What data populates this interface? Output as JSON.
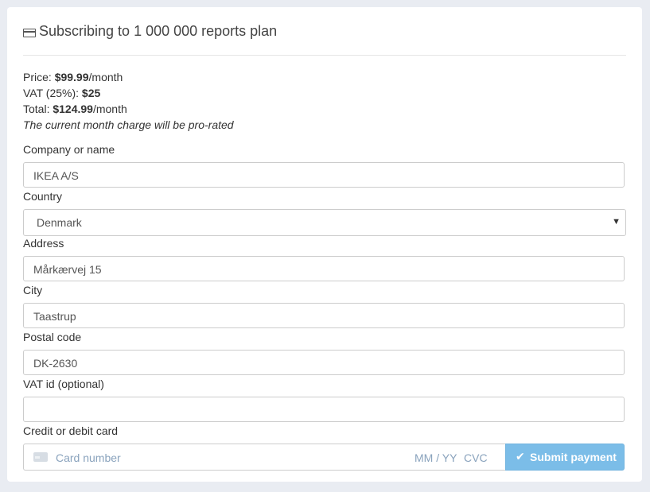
{
  "header": {
    "title": "Subscribing to 1 000 000 reports plan",
    "icon": "credit-card-icon"
  },
  "pricing": {
    "price_label": "Price: ",
    "price_value": "$99.99",
    "price_suffix": "/month",
    "vat_label": "VAT (25%): ",
    "vat_value": "$25",
    "total_label": "Total: ",
    "total_value": "$124.99",
    "total_suffix": "/month",
    "note": "The current month charge will be pro-rated"
  },
  "form": {
    "company": {
      "label": "Company or name",
      "value": "IKEA A/S"
    },
    "country": {
      "label": "Country",
      "value": "Denmark"
    },
    "address": {
      "label": "Address",
      "value": "Mårkærvej 15"
    },
    "city": {
      "label": "City",
      "value": "Taastrup"
    },
    "postal": {
      "label": "Postal code",
      "value": "DK-2630"
    },
    "vat_id": {
      "label": "VAT id (optional)",
      "value": ""
    },
    "card": {
      "label": "Credit or debit card",
      "number_placeholder": "Card number",
      "expiry_placeholder": "MM / YY",
      "cvc_placeholder": "CVC"
    },
    "submit_label": "Submit payment"
  },
  "colors": {
    "background": "#e9ecf2",
    "button": "#7bbde8",
    "placeholder": "#8aa3bd"
  }
}
